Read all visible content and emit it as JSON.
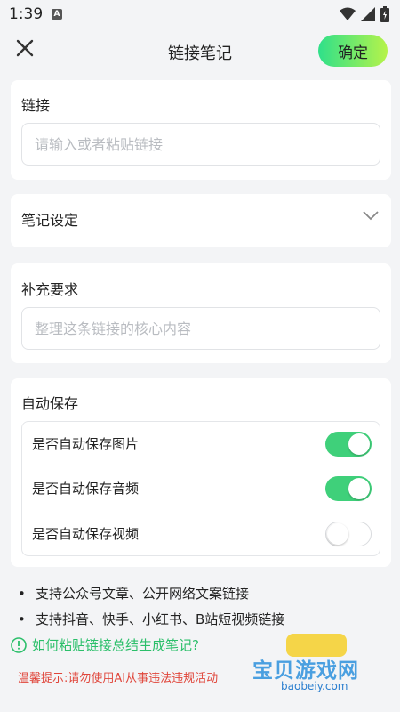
{
  "status": {
    "time": "1:39",
    "notification_icon": "A"
  },
  "header": {
    "title": "链接笔记",
    "confirm_label": "确定"
  },
  "link_section": {
    "label": "链接",
    "input_placeholder": "请输入或者粘贴链接",
    "input_value": ""
  },
  "note_settings": {
    "label": "笔记设定"
  },
  "extra_section": {
    "label": "补充要求",
    "input_placeholder": "整理这条链接的核心内容",
    "input_value": ""
  },
  "auto_save": {
    "label": "自动保存",
    "toggles": [
      {
        "label": "是否自动保存图片",
        "on": true
      },
      {
        "label": "是否自动保存音频",
        "on": true
      },
      {
        "label": "是否自动保存视频",
        "on": false
      }
    ]
  },
  "tips": [
    "支持公众号文章、公开网络文案链接",
    "支持抖音、快手、小红书、B站短视频链接"
  ],
  "help_link": "如何粘贴链接总结生成笔记?",
  "warning": "温馨提示:请勿使用AI从事违法违规活动",
  "watermark": {
    "title": "宝贝游戏网",
    "url": "baobeiy.com"
  },
  "colors": {
    "accent_green": "#3fd07a",
    "warning_red": "#e0453a",
    "help_green": "#2bbf6a"
  }
}
